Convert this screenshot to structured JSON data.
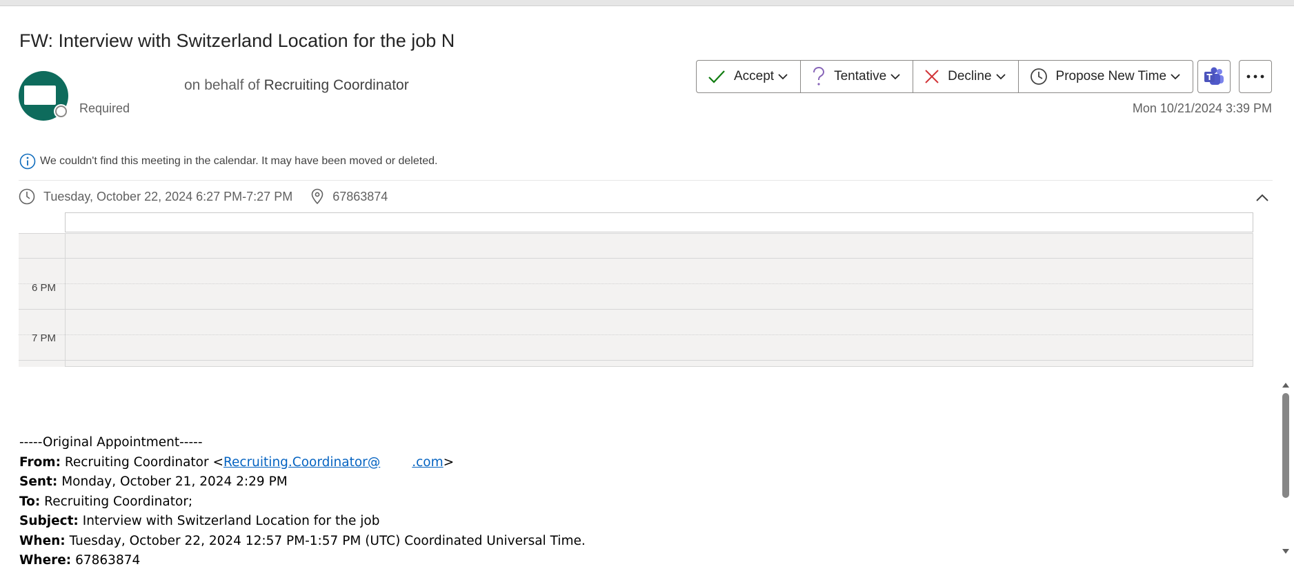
{
  "subject": "FW: Interview with Switzerland Location for the job N",
  "sender": {
    "on_behalf_prefix": "on behalf of",
    "on_behalf_name": "Recruiting Coordinator",
    "attendance": "Required",
    "sent_datetime": "Mon 10/21/2024 3:39 PM"
  },
  "actions": [
    {
      "label": "Accept",
      "icon": "check-icon",
      "color": "#107c10"
    },
    {
      "label": "Tentative",
      "icon": "question-icon",
      "color": "#8764b8"
    },
    {
      "label": "Decline",
      "icon": "x-icon",
      "color": "#d13438"
    },
    {
      "label": "Propose New Time",
      "icon": "clock-icon",
      "color": "#424242"
    }
  ],
  "teams_icon": "teams-icon",
  "more_icon": "more-icon",
  "notice": "We couldn't find this meeting in the calendar. It may have been moved or deleted.",
  "meeting": {
    "time": "Tuesday, October 22, 2024 6:27 PM-7:27 PM",
    "location": "67863874"
  },
  "calendar": {
    "hours": [
      "6 PM",
      "7 PM"
    ]
  },
  "original": {
    "heading": "-----Original Appointment-----",
    "from_label": "From:",
    "from_name": "Recruiting Coordinator <",
    "from_email": "Recruiting.Coordinator@",
    "from_email_domain": ".com",
    "from_close": ">",
    "sent_label": "Sent:",
    "sent_value": "Monday, October 21, 2024 2:29 PM",
    "to_label": "To:",
    "to_value": "Recruiting Coordinator;",
    "subject_label": "Subject:",
    "subject_value": "Interview with Switzerland Location for the job",
    "when_label": "When:",
    "when_value": "Tuesday, October 22, 2024 12:57 PM-1:57 PM (UTC) Coordinated Universal Time.",
    "where_label": "Where:",
    "where_value": "67863874"
  },
  "colors": {
    "avatar": "#0e6b5c",
    "link": "#0563c1",
    "info": "#0f6cbd",
    "teams": "#5059c9"
  }
}
